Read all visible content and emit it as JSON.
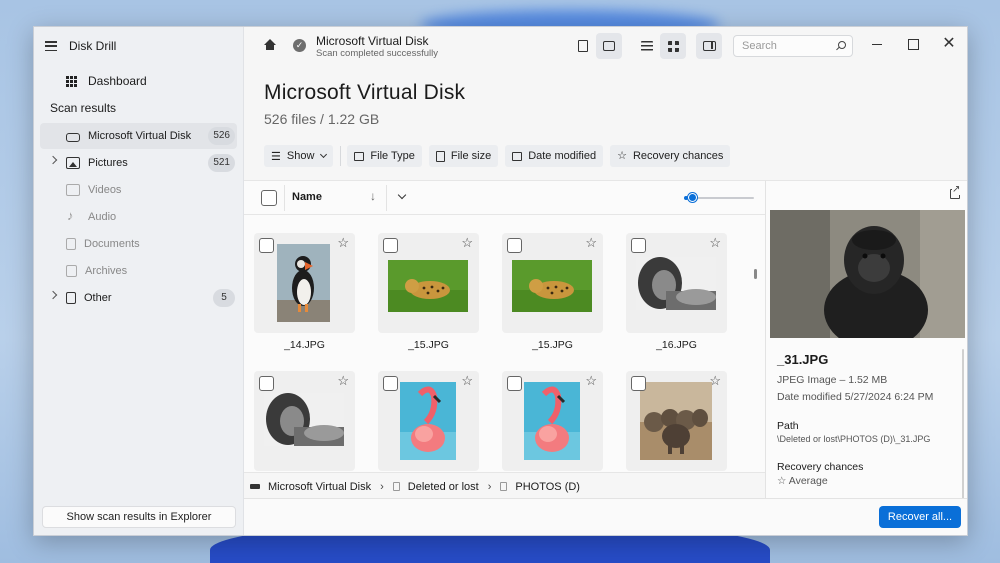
{
  "app": {
    "title": "Disk Drill"
  },
  "sidebar": {
    "dashboard_label": "Dashboard",
    "section_title": "Scan results",
    "items": [
      {
        "label": "Microsoft Virtual Disk",
        "count": "526"
      },
      {
        "label": "Pictures",
        "count": "521"
      },
      {
        "label": "Videos"
      },
      {
        "label": "Audio"
      },
      {
        "label": "Documents"
      },
      {
        "label": "Archives"
      },
      {
        "label": "Other",
        "count": "5"
      }
    ],
    "explorer_button": "Show scan results in Explorer"
  },
  "header": {
    "device_title": "Microsoft Virtual Disk",
    "status": "Scan completed successfully",
    "search_placeholder": "Search"
  },
  "main": {
    "title": "Microsoft Virtual Disk",
    "subtitle": "526 files / 1.22 GB",
    "filters": {
      "show": "Show",
      "file_type": "File Type",
      "file_size": "File size",
      "date_modified": "Date modified",
      "recovery_chances": "Recovery chances"
    },
    "column_name": "Name",
    "sort_arrow": "↓",
    "tiles": [
      {
        "name": "_14.JPG",
        "icon": "puffin-photo"
      },
      {
        "name": "_15.JPG",
        "icon": "leopard-photo"
      },
      {
        "name": "_15.JPG",
        "icon": "leopard-photo"
      },
      {
        "name": "_16.JPG",
        "icon": "lion-bw-photo"
      },
      {
        "name": "",
        "icon": "lion-bw-photo"
      },
      {
        "name": "",
        "icon": "flamingo-photo"
      },
      {
        "name": "",
        "icon": "flamingo-photo"
      },
      {
        "name": "",
        "icon": "elephants-photo"
      }
    ]
  },
  "breadcrumb": {
    "items": [
      "Microsoft Virtual Disk",
      "Deleted or lost",
      "PHOTOS (D)"
    ]
  },
  "preview": {
    "file_name": "_31.JPG",
    "file_type": "JPEG Image – 1.52 MB",
    "date_modified": "Date modified 5/27/2024 6:24 PM",
    "path_label": "Path",
    "path_value": "\\Deleted or lost\\PHOTOS (D)\\_31.JPG",
    "recovery_label": "Recovery chances",
    "recovery_value": "Average"
  },
  "footer": {
    "recover_button": "Recover all..."
  },
  "colors": {
    "accent": "#0a6fd8"
  }
}
